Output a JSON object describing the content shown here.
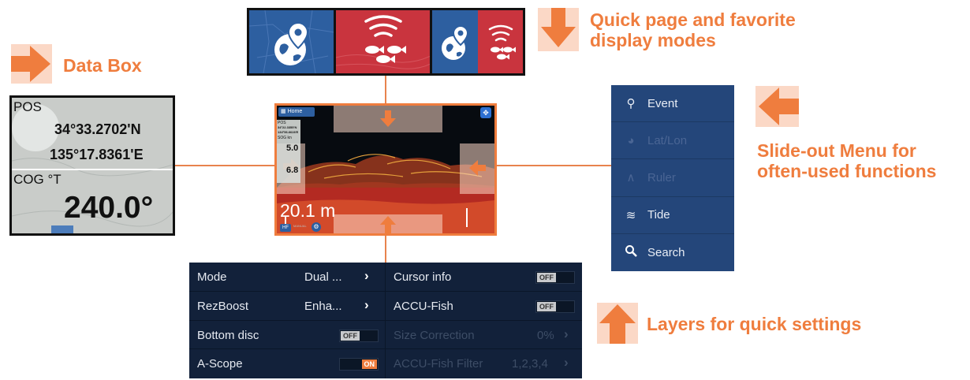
{
  "callouts": {
    "quick_page": "Quick page and favorite display modes",
    "data_box": "Data Box",
    "slide_out": "Slide-out Menu for often-used functions",
    "layers": "Layers for quick settings"
  },
  "data_box": {
    "pos_label": "POS",
    "lat": "34°33.2702'N",
    "lon": "135°17.8361'E",
    "cog_label": "COG °T",
    "cog_value": "240.0°"
  },
  "sonar": {
    "home_label": "Home",
    "pos_label": "POS",
    "mini_lat": "34°22.3355'N",
    "mini_lon": "134°56.6628'E",
    "sog_label": "SOG kn",
    "sog_value": "5.0",
    "second_value": "6.8",
    "depth": "20.1 m",
    "freq_badge": "HF",
    "mode_small": "MANUAL"
  },
  "slide_menu": {
    "items": [
      {
        "label": "Event",
        "icon": "event-icon",
        "enabled": true
      },
      {
        "label": "Lat/Lon",
        "icon": "latlon-icon",
        "enabled": false
      },
      {
        "label": "Ruler",
        "icon": "ruler-icon",
        "enabled": false
      },
      {
        "label": "Tide",
        "icon": "tide-icon",
        "enabled": true
      },
      {
        "label": "Search",
        "icon": "search-icon",
        "enabled": true
      }
    ]
  },
  "layers": {
    "left": [
      {
        "label": "Mode",
        "value": "Dual ...",
        "control": "chevron",
        "enabled": true
      },
      {
        "label": "RezBoost",
        "value": "Enha...",
        "control": "chevron",
        "enabled": true
      },
      {
        "label": "Bottom disc",
        "value": "OFF",
        "control": "toggle-off",
        "enabled": true
      },
      {
        "label": "A-Scope",
        "value": "ON",
        "control": "toggle-on",
        "enabled": true
      }
    ],
    "right": [
      {
        "label": "Cursor info",
        "value": "OFF",
        "control": "toggle-off",
        "enabled": true
      },
      {
        "label": "ACCU-Fish",
        "value": "OFF",
        "control": "toggle-off",
        "enabled": true
      },
      {
        "label": "Size Correction",
        "value": "0%",
        "control": "chevron",
        "enabled": false
      },
      {
        "label": "ACCU-Fish Filter",
        "value": "1,2,3,4",
        "control": "chevron",
        "enabled": false
      }
    ]
  },
  "colors": {
    "accent": "#ef7d3e",
    "menu_bg": "#24467a",
    "layers_bg": "#12213a",
    "tile_blue": "#2d5fa0",
    "tile_red": "#c9343e",
    "toggle_on": "#ef7d3e"
  }
}
